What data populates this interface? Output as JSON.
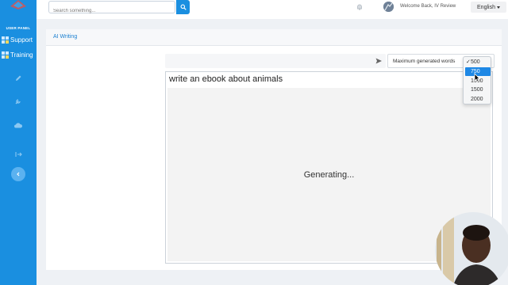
{
  "sidebar": {
    "panel_label": "USER PANEL",
    "links": [
      {
        "label": "Support",
        "icon": "grid-icon"
      },
      {
        "label": "Training",
        "icon": "grid-icon"
      }
    ],
    "icons": [
      "pencil-icon",
      "wrench-icon",
      "cloud-icon",
      "logout-icon"
    ],
    "collapse_icon": "chevron-left-icon",
    "color": "#1a8fe0"
  },
  "topbar": {
    "search_placeholder": "Search something...",
    "welcome": "Welcome Back, IV Review",
    "language": "English"
  },
  "page": {
    "title": "AI Writing"
  },
  "writer": {
    "max_words_label": "Maximum generated words",
    "options": [
      "500",
      "750",
      "1000",
      "1500",
      "2000"
    ],
    "checked_option": "500",
    "highlighted_option": "750",
    "output_title": "write an ebook about animals",
    "status": "Generating..."
  },
  "accent_color": "#1e88e5"
}
